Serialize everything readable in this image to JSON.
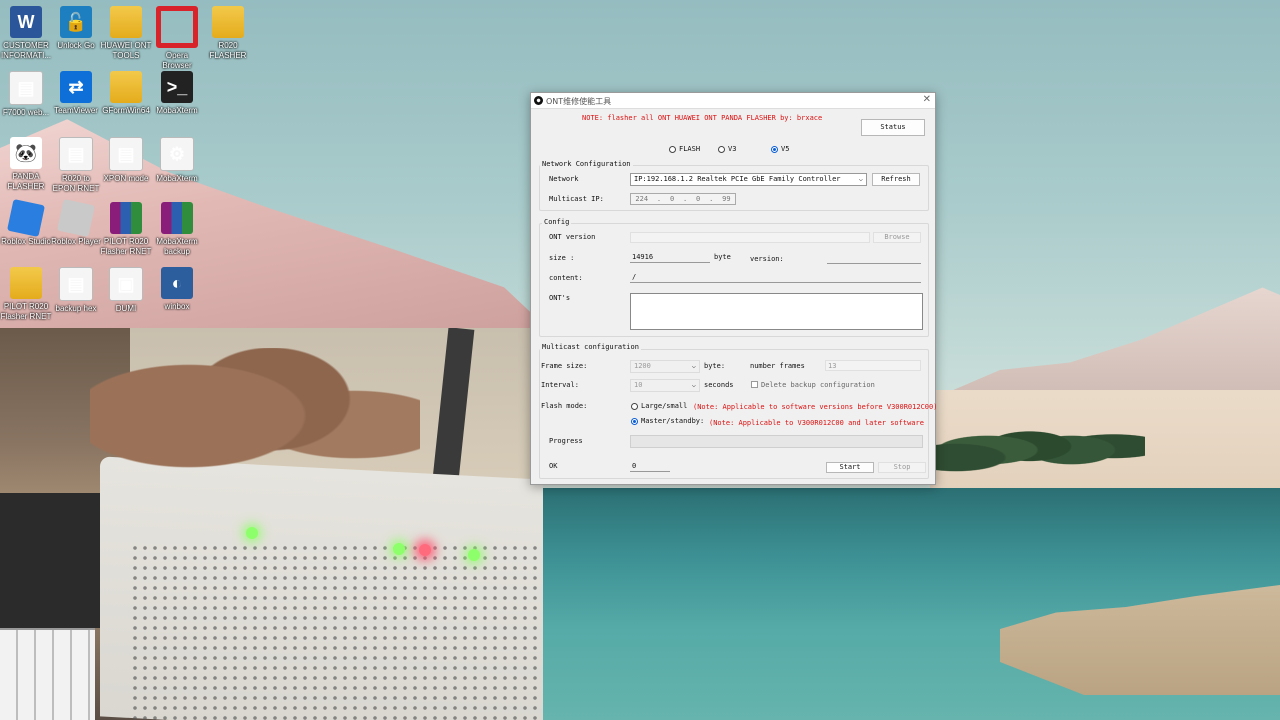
{
  "desktop": {
    "icons": [
      {
        "label": "CUSTOMER INFORMATI...",
        "glyph": "W"
      },
      {
        "label": "Unlock Go",
        "glyph": "🔓"
      },
      {
        "label": "HUAWEI ONT TOOLS",
        "glyph": ""
      },
      {
        "label": "Opera Browser",
        "glyph": ""
      },
      {
        "label": "R020 FLASHER",
        "glyph": ""
      },
      {
        "label": "F7000 web...",
        "glyph": "▤"
      },
      {
        "label": "TeamViewer",
        "glyph": "⇄"
      },
      {
        "label": "GFormWin64",
        "glyph": ""
      },
      {
        "label": "MobaXterm",
        "glyph": ">_"
      },
      {
        "label": "PANDA FLASHER",
        "glyph": "🐼"
      },
      {
        "label": "R020 to EPON RNET",
        "glyph": "▤"
      },
      {
        "label": "XPON mode",
        "glyph": "▤"
      },
      {
        "label": "MobaXterm",
        "glyph": "⚙"
      },
      {
        "label": "Roblox Studio",
        "glyph": ""
      },
      {
        "label": "Roblox Player",
        "glyph": ""
      },
      {
        "label": "PILOT R020 Flasher RNET",
        "glyph": ""
      },
      {
        "label": "MobaXterm backup",
        "glyph": ""
      },
      {
        "label": "PILOT R020 Flasher RNET",
        "glyph": ""
      },
      {
        "label": "backup hex",
        "glyph": "▤"
      },
      {
        "label": "DUMI",
        "glyph": "▣"
      },
      {
        "label": "winbox",
        "glyph": "◐"
      }
    ]
  },
  "window": {
    "title": "ONT维修使能工具",
    "note": "NOTE: flasher all ONT HUAWEI ONT PANDA FLASHER by: brxace",
    "status_label": "Status",
    "radios": {
      "flash": "FLASH",
      "v3": "V3",
      "v5": "V5",
      "selected": "V5"
    },
    "network_group": "Network Configuration",
    "network_label": "Network",
    "network_value": "IP:192.168.1.2 Realtek PCIe GbE Family Controller",
    "refresh_label": "Refresh",
    "multicast_label": "Multicast IP:",
    "multicast_ip": [
      "224",
      "0",
      "0",
      "99"
    ],
    "config_group": "Config",
    "ont_version_label": "ONT version",
    "browse_label": "Browse",
    "size_label": "size :",
    "size_value": "14916",
    "byte_label": "byte",
    "version_label": "version:",
    "content_label": "content:",
    "content_value": "/",
    "onts_label": "ONT's",
    "multicast_group": "Multicast configuration",
    "frame_size_label": "Frame size:",
    "frame_size_value": "1200",
    "frame_byte_label": "byte:",
    "number_frames_label": "number frames",
    "number_frames_value": "13",
    "interval_label": "Interval:",
    "interval_value": "10",
    "seconds_label": "seconds",
    "delete_backup_label": "Delete backup configuration",
    "flash_mode_label": "Flash mode:",
    "large_small_label": "Large/small",
    "large_small_note": "(Note: Applicable to software versions before V300R012C00)",
    "master_standby_label": "Master/standby:",
    "master_standby_note": "(Note: Applicable to V300R012C00 and later software",
    "flash_mode_selected": "Master/standby",
    "progress_label": "Progress",
    "progress_value": 0,
    "ok_label": "OK",
    "ok_value": "0",
    "start_label": "Start",
    "stop_label": "Stop"
  },
  "colors": {
    "note_red": "#dd1111",
    "radio_blue": "#0b5ed7",
    "progress_green": "#06b025"
  }
}
